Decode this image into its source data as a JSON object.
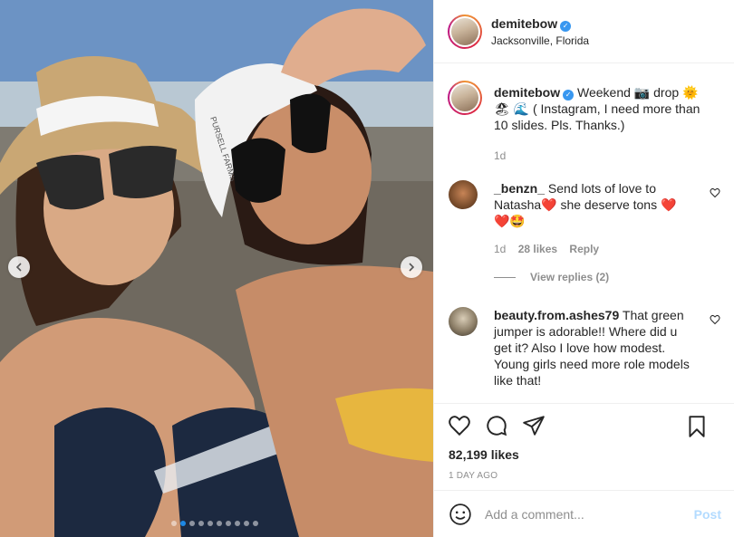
{
  "header": {
    "username": "demitebow",
    "verified": true,
    "location": "Jacksonville, Florida"
  },
  "photo": {
    "hat_text": "PURSELL FARMS",
    "slide_count": 10,
    "active_slide": 2
  },
  "caption": {
    "username": "demitebow",
    "text": "Weekend 📷 drop 🌞 🏖 🌊 ( Instagram, I need more than 10 slides. Pls. Thanks.)",
    "time": "1d"
  },
  "comments": [
    {
      "username": "_benzn_",
      "text": "Send lots of love to Natasha❤️ she deserve tons ❤️ ❤️🤩",
      "time": "1d",
      "likes": "28 likes",
      "reply": "Reply"
    },
    {
      "username": "beauty.from.ashes79",
      "text": "That green jumper is adorable!! Where did u get it? Also I love how modest. Young girls need more role models like that!"
    }
  ],
  "view_replies": "View replies (2)",
  "likes": "82,199 likes",
  "date": "1 DAY AGO",
  "add_comment": {
    "placeholder": "Add a comment...",
    "post_label": "Post"
  },
  "colors": {
    "verified": "#3897f0",
    "post_button": "#b3dbff",
    "active_dot": "#1e88e5"
  }
}
